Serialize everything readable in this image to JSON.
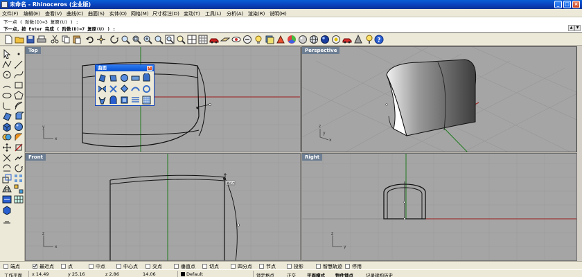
{
  "window": {
    "title": "未命名 - Rhinoceros (企业版)",
    "minimize": "_",
    "maximize": "□",
    "close": "×"
  },
  "menu": [
    "文件(F)",
    "编辑(E)",
    "查看(V)",
    "曲线(C)",
    "曲面(S)",
    "实体(O)",
    "网格(M)",
    "尺寸标注(D)",
    "变动(T)",
    "工具(L)",
    "分析(A)",
    "渲染(R)",
    "说明(H)"
  ],
  "command": {
    "history": "下一点 ( 阶数(D)=3  复原(U) ) :",
    "prompt": "下一点，按 Enter 完成 ( 阶数(D)=7  复原(U) ) :",
    "scroll_up": "▲",
    "scroll_down": "▼"
  },
  "toolbar_icons": [
    "new-icon",
    "open-icon",
    "save-icon",
    "print-icon",
    "cut-icon",
    "copy-icon",
    "paste-icon",
    "undo-icon",
    "pan-icon",
    "rotate-view-icon",
    "zoom-icon",
    "zoom-window-icon",
    "zoom-extents-icon",
    "zoom-selected-icon",
    "zoom-all-icon",
    "undo-view-icon",
    "four-view-icon",
    "grid-icon",
    "car-icon",
    "cplane-icon",
    "show-icon",
    "lock-icon",
    "light-icon",
    "layer-icon",
    "color-circle-icon",
    "globe-icon",
    "render-icon",
    "material-icon",
    "help-icon"
  ],
  "left_tools": [
    "select-arrow-icon",
    "point-icon",
    "polyline-icon",
    "curve-icon",
    "circle-icon",
    "arc-icon",
    "ellipse-icon",
    "rectangle-icon",
    "polygon-icon",
    "fillet-curve-icon",
    "surface-corner-icon",
    "extrude-icon",
    "box-icon",
    "sphere-icon",
    "boolean-union-icon",
    "fillet-edge-icon",
    "move-icon",
    "split-icon",
    "trim-icon",
    "join-icon",
    "explode-icon",
    "scale-icon",
    "array-icon",
    "mirror-icon",
    "group-icon",
    "dimension-icon",
    "mesh-icon",
    "text-icon"
  ],
  "viewports": {
    "top": {
      "label": "Top",
      "axis_x": "x",
      "axis_y": "y"
    },
    "perspective": {
      "label": "Perspective",
      "axis_x": "x",
      "axis_y": "y",
      "axis_z": "z"
    },
    "front": {
      "label": "Front",
      "axis_x": "x",
      "axis_z": "z",
      "osnap_tag": "最近点"
    },
    "right": {
      "label": "Right",
      "axis_y": "y",
      "axis_z": "z"
    }
  },
  "float_panel": {
    "title": "曲面",
    "close": "×",
    "icons": [
      "surface-from-points-icon",
      "surface-from-edges-icon",
      "rectangle-plane-icon",
      "extrude-curve-icon",
      "loft-icon",
      "sweep1-icon",
      "sweep2-icon",
      "network-icon",
      "revolve-icon",
      "rail-revolve-icon",
      "patch-icon",
      "drape-icon",
      "blend-icon",
      "offset-surface-icon",
      "surface-from-grid-icon"
    ]
  },
  "osnaps": [
    {
      "label": "端点",
      "checked": false
    },
    {
      "label": "最近点",
      "checked": true
    },
    {
      "label": "点",
      "checked": false
    },
    {
      "label": "中点",
      "checked": false
    },
    {
      "label": "中心点",
      "checked": false
    },
    {
      "label": "交点",
      "checked": false
    },
    {
      "label": "垂直点",
      "checked": false
    },
    {
      "label": "切点",
      "checked": false
    },
    {
      "label": "四分点",
      "checked": false
    },
    {
      "label": "节点",
      "checked": false
    },
    {
      "label": "投影",
      "checked": false
    },
    {
      "label": "智慧轨迹",
      "checked": false
    },
    {
      "label": "停用",
      "checked": false
    }
  ],
  "status": {
    "cplane": "工作平面",
    "x": "x 14.49",
    "y": "y 25.16",
    "z": "z 2.86",
    "distance": "14.06",
    "layer": "Default",
    "grid_snap": "锁定格点",
    "ortho": "正交",
    "planar": "平面模式",
    "object_snap": "物件锁点",
    "history": "记录建构历史"
  },
  "colors": {
    "viewport_bg": "#a5a5a5",
    "grid_line": "#999999",
    "axis_x": "#9c1c1c",
    "axis_y": "#1f7a1f",
    "label_bg": "#6d7e92",
    "title_blue": "#0a4fd0"
  }
}
